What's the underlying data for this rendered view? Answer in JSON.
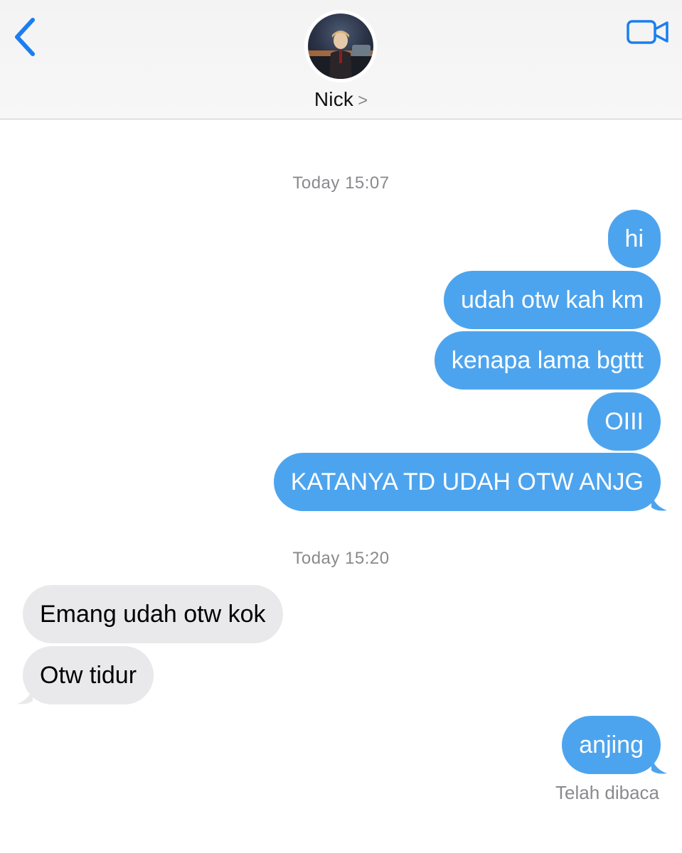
{
  "header": {
    "contact_name": "Nick",
    "contact_chevron": ">",
    "back_icon": "chevron-left-icon",
    "video_icon": "video-camera-icon",
    "accent_color": "#1a7ef0"
  },
  "conversation": {
    "timestamps": [
      "Today 15:07",
      "Today 15:20"
    ],
    "messages": [
      {
        "direction": "outgoing",
        "text": "hi"
      },
      {
        "direction": "outgoing",
        "text": "udah otw kah km"
      },
      {
        "direction": "outgoing",
        "text": "kenapa lama bgttt"
      },
      {
        "direction": "outgoing",
        "text": "OIII"
      },
      {
        "direction": "outgoing",
        "text": "KATANYA TD UDAH OTW ANJG"
      },
      {
        "direction": "incoming",
        "text": "Emang udah otw kok"
      },
      {
        "direction": "incoming",
        "text": "Otw tidur"
      },
      {
        "direction": "outgoing",
        "text": "anjing"
      }
    ],
    "read_receipt": "Telah dibaca",
    "outgoing_color": "#4da4ee",
    "incoming_color": "#e9e9eb"
  }
}
